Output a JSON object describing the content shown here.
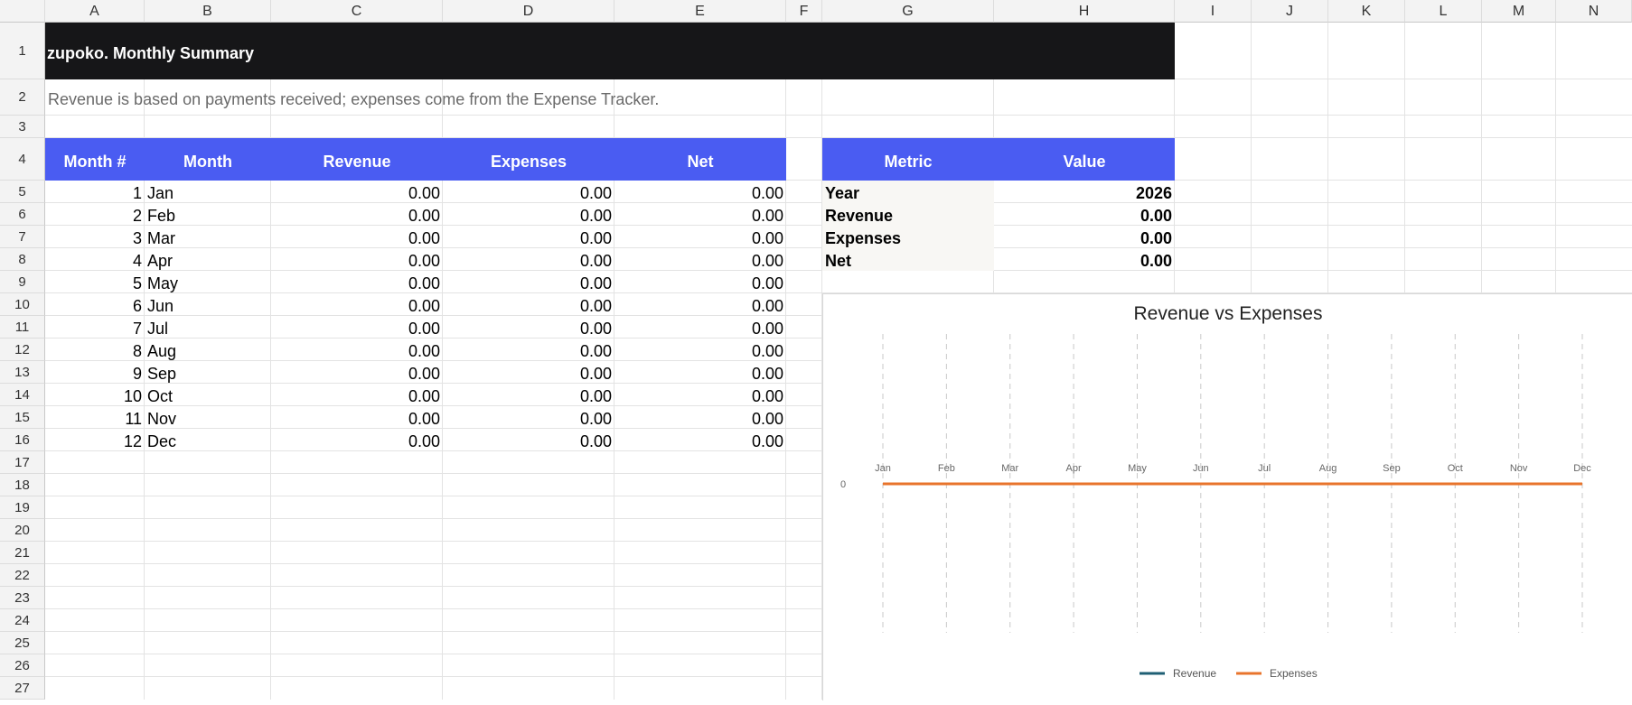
{
  "columns": [
    "A",
    "B",
    "C",
    "D",
    "E",
    "F",
    "G",
    "H",
    "I",
    "J",
    "K",
    "L",
    "M",
    "N"
  ],
  "rows": [
    "1",
    "2",
    "3",
    "4",
    "5",
    "6",
    "7",
    "8",
    "9",
    "10",
    "11",
    "12",
    "13",
    "14",
    "15",
    "16",
    "17",
    "18",
    "19",
    "20",
    "21",
    "22",
    "23",
    "24",
    "25",
    "26",
    "27"
  ],
  "title": "zupoko.  Monthly Summary",
  "subtitle": "Revenue is based on payments received; expenses come from the Expense Tracker.",
  "monthly_table": {
    "headers": [
      "Month #",
      "Month",
      "Revenue",
      "Expenses",
      "Net"
    ],
    "rows": [
      {
        "num": "1",
        "month": "Jan",
        "revenue": "0.00",
        "expenses": "0.00",
        "net": "0.00"
      },
      {
        "num": "2",
        "month": "Feb",
        "revenue": "0.00",
        "expenses": "0.00",
        "net": "0.00"
      },
      {
        "num": "3",
        "month": "Mar",
        "revenue": "0.00",
        "expenses": "0.00",
        "net": "0.00"
      },
      {
        "num": "4",
        "month": "Apr",
        "revenue": "0.00",
        "expenses": "0.00",
        "net": "0.00"
      },
      {
        "num": "5",
        "month": "May",
        "revenue": "0.00",
        "expenses": "0.00",
        "net": "0.00"
      },
      {
        "num": "6",
        "month": "Jun",
        "revenue": "0.00",
        "expenses": "0.00",
        "net": "0.00"
      },
      {
        "num": "7",
        "month": "Jul",
        "revenue": "0.00",
        "expenses": "0.00",
        "net": "0.00"
      },
      {
        "num": "8",
        "month": "Aug",
        "revenue": "0.00",
        "expenses": "0.00",
        "net": "0.00"
      },
      {
        "num": "9",
        "month": "Sep",
        "revenue": "0.00",
        "expenses": "0.00",
        "net": "0.00"
      },
      {
        "num": "10",
        "month": "Oct",
        "revenue": "0.00",
        "expenses": "0.00",
        "net": "0.00"
      },
      {
        "num": "11",
        "month": "Nov",
        "revenue": "0.00",
        "expenses": "0.00",
        "net": "0.00"
      },
      {
        "num": "12",
        "month": "Dec",
        "revenue": "0.00",
        "expenses": "0.00",
        "net": "0.00"
      }
    ]
  },
  "metrics_table": {
    "headers": [
      "Metric",
      "Value"
    ],
    "rows": [
      {
        "metric": "Year",
        "value": "2026"
      },
      {
        "metric": "Revenue",
        "value": "0.00"
      },
      {
        "metric": "Expenses",
        "value": "0.00"
      },
      {
        "metric": "Net",
        "value": "0.00"
      }
    ]
  },
  "colors": {
    "title_bg": "#161618",
    "header_bg": "#4a5cf2",
    "revenue_line": "#1f5f74",
    "expenses_line": "#e8742c"
  },
  "chart_data": {
    "type": "line",
    "title": "Revenue vs Expenses",
    "categories": [
      "Jan",
      "Feb",
      "Mar",
      "Apr",
      "May",
      "Jun",
      "Jul",
      "Aug",
      "Sep",
      "Oct",
      "Nov",
      "Dec"
    ],
    "series": [
      {
        "name": "Revenue",
        "values": [
          0,
          0,
          0,
          0,
          0,
          0,
          0,
          0,
          0,
          0,
          0,
          0
        ]
      },
      {
        "name": "Expenses",
        "values": [
          0,
          0,
          0,
          0,
          0,
          0,
          0,
          0,
          0,
          0,
          0,
          0
        ]
      }
    ],
    "ytick_labels": [
      "0"
    ],
    "grid": "vertical dashed",
    "legend": "bottom"
  }
}
